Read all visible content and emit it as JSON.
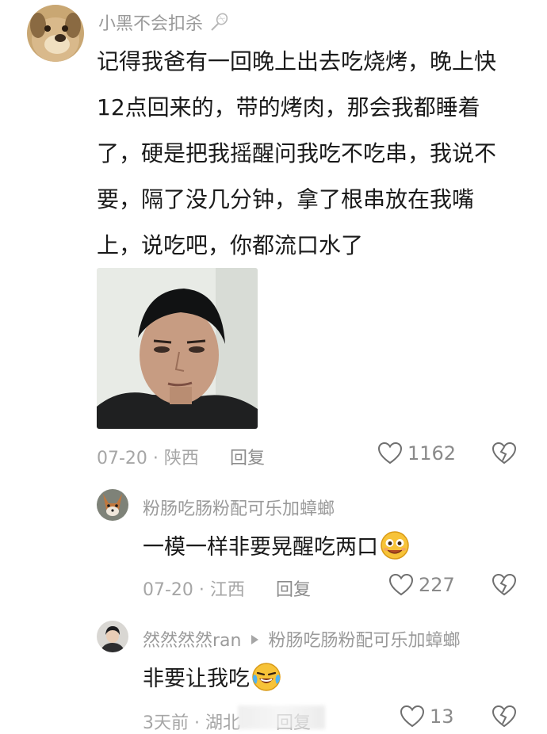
{
  "comment": {
    "username": "小黑不会扣杀",
    "text_lines": [
      "记得我爸有一回晚上出去吃烧烤，晚上快",
      "12点回来的，带的烤肉，那会我都睡着",
      "了，硬是把我摇醒问我吃不吃串，我说不",
      "要，隔了没几分钟，拿了根串放在我嘴",
      "上，说吃吧，你都流口水了"
    ],
    "meta": "07-20 · 陕西",
    "reply_label": "回复",
    "likes": "1162"
  },
  "replies": [
    {
      "username": "粉肠吃肠粉配可乐加蟑螂",
      "text": "一模一样非要晃醒吃两口",
      "meta": "07-20 · 江西",
      "reply_label": "回复",
      "likes": "227"
    },
    {
      "username": "然然然然ran",
      "reply_to": "粉肠吃肠粉配可乐加蟑螂",
      "text": "非要让我吃",
      "meta": "3天前 · 湖北",
      "reply_label": "回复",
      "likes": "13"
    }
  ],
  "icons": {
    "badminton": "badminton-racket-icon",
    "like": "heart-outline-icon",
    "dislike": "broken-heart-icon",
    "reply_arrow": "triangle-right-icon",
    "emoji_smile": "smiling-face-emoji",
    "emoji_cry": "crying-laughing-emoji"
  },
  "colors": {
    "text": "#1a1a1a",
    "username": "#9a9a9a",
    "meta": "#a6a6a6"
  }
}
